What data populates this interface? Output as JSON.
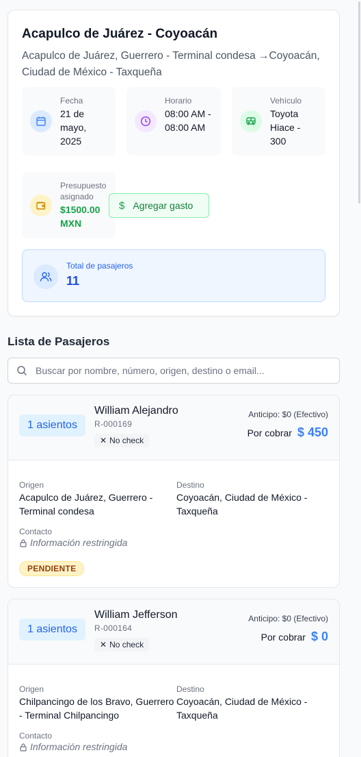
{
  "trip": {
    "title": "Acapulco de Juárez - Coyoacán",
    "route": "Acapulco de Juárez, Guerrero - Terminal condesa →Coyoacán, Ciudad de México - Taxqueña",
    "date_label": "Fecha",
    "date_value": "21 de mayo, 2025",
    "time_label": "Horario",
    "time_value": "08:00 AM - 08:00 AM",
    "vehicle_label": "Vehículo",
    "vehicle_value": "Toyota Hiace - 300",
    "budget_label": "Presupuesto asignado",
    "budget_value": "$1500.00 MXN",
    "add_expense_label": "Agregar gasto",
    "passengers_label": "Total de pasajeros",
    "passengers_value": "11"
  },
  "list": {
    "title": "Lista de Pasajeros",
    "search_placeholder": "Buscar por nombre, número, origen, destino o email..."
  },
  "labels": {
    "origin": "Origen",
    "destination": "Destino",
    "contact": "Contacto",
    "restricted": "Información restringida",
    "por_cobrar": "Por cobrar"
  },
  "passengers": [
    {
      "seats": "1 asientos",
      "name": "William Alejandro",
      "code": "R-000169",
      "check": "No check",
      "anticipo": "Anticipo: $0 (Efectivo)",
      "amount": "$ 450",
      "origin": "Acapulco de Juárez, Guerrero - Terminal condesa",
      "destination": "Coyoacán, Ciudad de México - Taxqueña",
      "status": "PENDIENTE"
    },
    {
      "seats": "1 asientos",
      "name": "William Jefferson",
      "code": "R-000164",
      "check": "No check",
      "anticipo": "Anticipo: $0 (Efectivo)",
      "amount": "$ 0",
      "origin": "Chilpancingo de los Bravo, Guerrero - Terminal Chilpancingo",
      "destination": "Coyoacán, Ciudad de México - Taxqueña"
    }
  ],
  "colors": {
    "accent": "#3b82f6",
    "success": "#15803d",
    "pending": "#fef3c7"
  }
}
